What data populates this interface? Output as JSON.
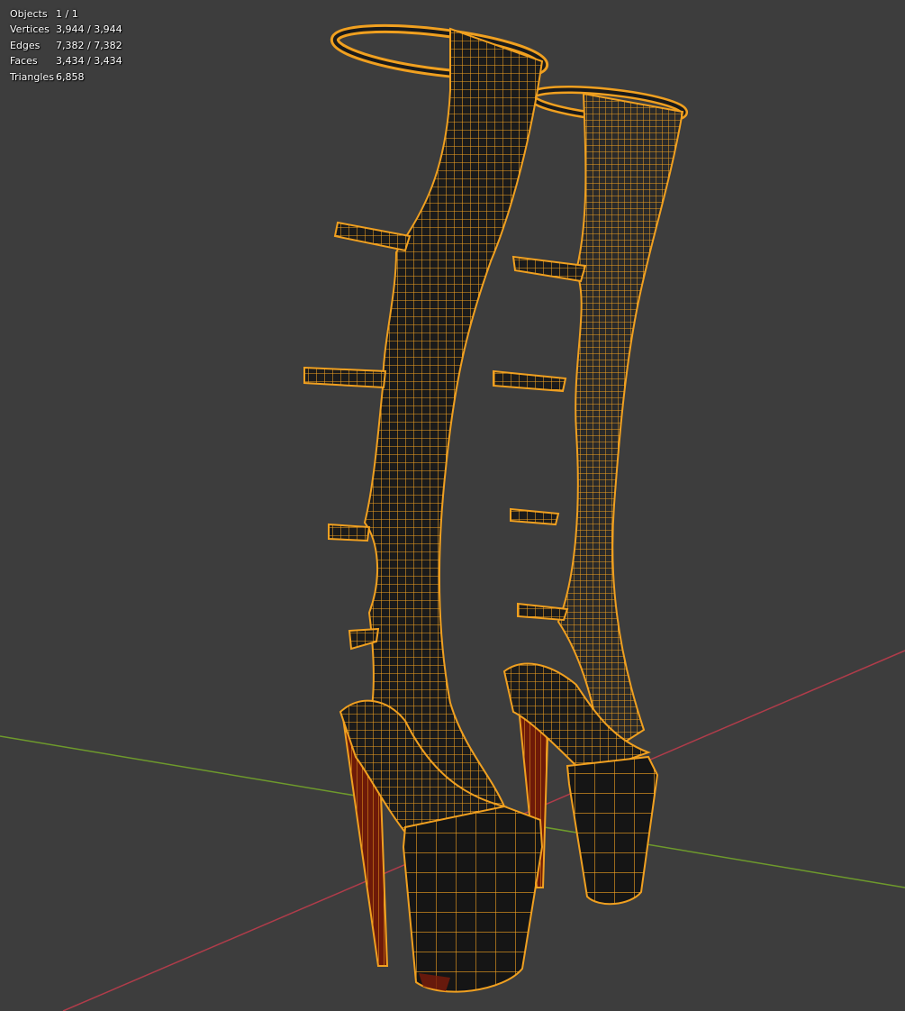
{
  "stats": [
    {
      "label": "Objects",
      "value": "1 / 1"
    },
    {
      "label": "Vertices",
      "value": "3,944 / 3,944"
    },
    {
      "label": "Edges",
      "value": "7,382 / 7,382"
    },
    {
      "label": "Faces",
      "value": "3,434 / 3,434"
    },
    {
      "label": "Triangles",
      "value": "6,858"
    }
  ],
  "colors": {
    "background": "#3d3d3d",
    "x_axis": "#b03c4a",
    "y_axis": "#6e9a2c",
    "wire": "#f0a020",
    "mesh_dark": "#161616",
    "heel_red": "#7a1a0a"
  },
  "scene": {
    "object": "knee-high platform boots mesh (edit mode, all selected)"
  }
}
